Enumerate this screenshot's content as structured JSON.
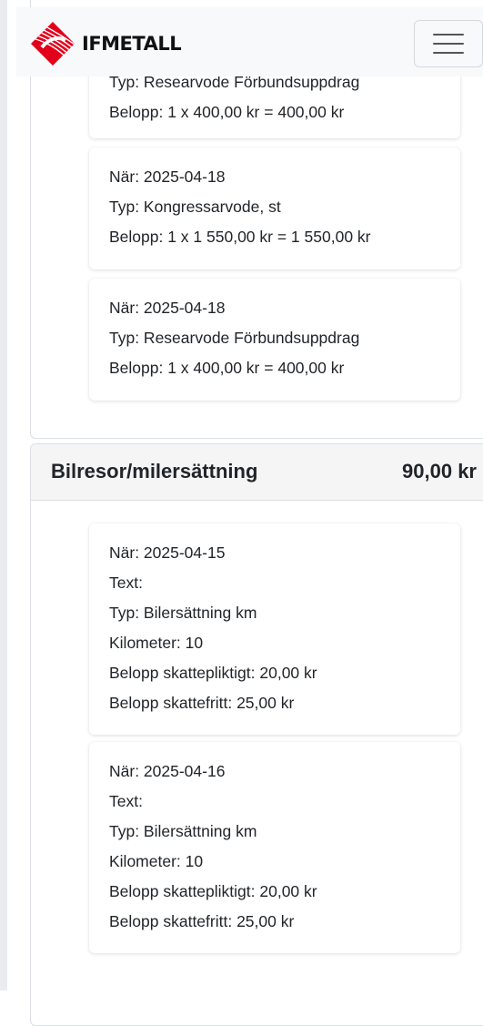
{
  "navbar": {
    "logo_text": "IFMETALL",
    "colors": {
      "logo_red": "#e2001a",
      "background": "#f8f9fa"
    }
  },
  "section_arvoden": {
    "partial_entry": {
      "typ": "Typ: Researvode Förbundsuppdrag",
      "belopp": "Belopp: 1 x 400,00 kr = 400,00 kr"
    },
    "entries": [
      {
        "nar": "När: 2025-04-18",
        "typ": "Typ: Kongressarvode, st",
        "belopp": "Belopp: 1 x 1 550,00 kr = 1 550,00 kr"
      },
      {
        "nar": "När: 2025-04-18",
        "typ": "Typ: Researvode Förbundsuppdrag",
        "belopp": "Belopp: 1 x 400,00 kr = 400,00 kr"
      }
    ]
  },
  "section_bilresor": {
    "title": "Bilresor/milersättning",
    "total": "90,00 kr",
    "entries": [
      {
        "nar": "När: 2025-04-15",
        "text": "Text:",
        "typ": "Typ: Bilersättning km",
        "kilometer": "Kilometer: 10",
        "skattepliktigt": "Belopp skattepliktigt: 20,00 kr",
        "skattefritt": "Belopp skattefritt: 25,00 kr"
      },
      {
        "nar": "När: 2025-04-16",
        "text": "Text:",
        "typ": "Typ: Bilersättning km",
        "kilometer": "Kilometer: 10",
        "skattepliktigt": "Belopp skattepliktigt: 20,00 kr",
        "skattefritt": "Belopp skattefritt: 25,00 kr"
      }
    ]
  }
}
